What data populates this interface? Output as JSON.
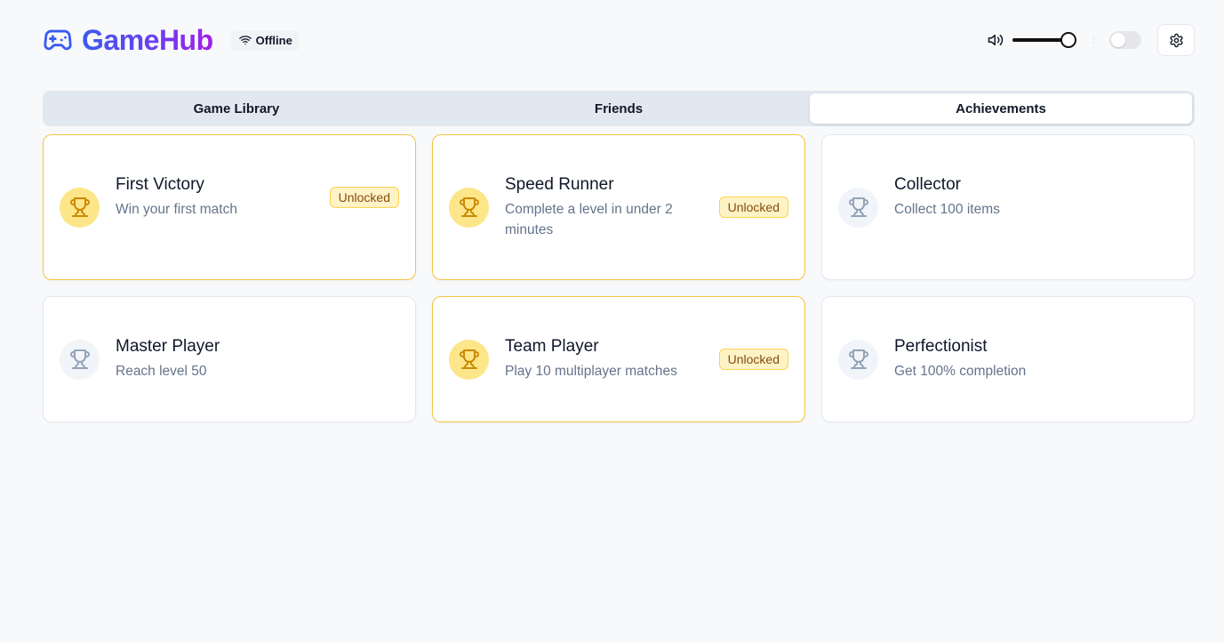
{
  "app": {
    "title": "GameHub",
    "status": "Offline",
    "volume_level": 0.88,
    "toggle_on": false
  },
  "tabs": [
    {
      "label": "Game Library",
      "active": false
    },
    {
      "label": "Friends",
      "active": false
    },
    {
      "label": "Achievements",
      "active": true
    }
  ],
  "achievements": [
    {
      "title": "First Victory",
      "description": "Win your first match",
      "unlocked": true,
      "badge": "Unlocked"
    },
    {
      "title": "Speed Runner",
      "description": "Complete a level in under 2 minutes",
      "unlocked": true,
      "badge": "Unlocked"
    },
    {
      "title": "Collector",
      "description": "Collect 100 items",
      "unlocked": false,
      "badge": ""
    },
    {
      "title": "Master Player",
      "description": "Reach level 50",
      "unlocked": false,
      "badge": ""
    },
    {
      "title": "Team Player",
      "description": "Play 10 multiplayer matches",
      "unlocked": true,
      "badge": "Unlocked"
    },
    {
      "title": "Perfectionist",
      "description": "Get 100% completion",
      "unlocked": false,
      "badge": ""
    }
  ],
  "colors": {
    "brand_start": "#3b5bf0",
    "brand_end": "#a21ee8",
    "unlocked_border": "#f5c542",
    "trophy_unlocked": "#ca8a04",
    "trophy_locked": "#94a3b8"
  },
  "icons": {
    "logo": "gamepad-icon",
    "status": "wifi-icon",
    "volume": "volume-icon",
    "settings": "gear-icon",
    "achievement": "trophy-icon"
  }
}
